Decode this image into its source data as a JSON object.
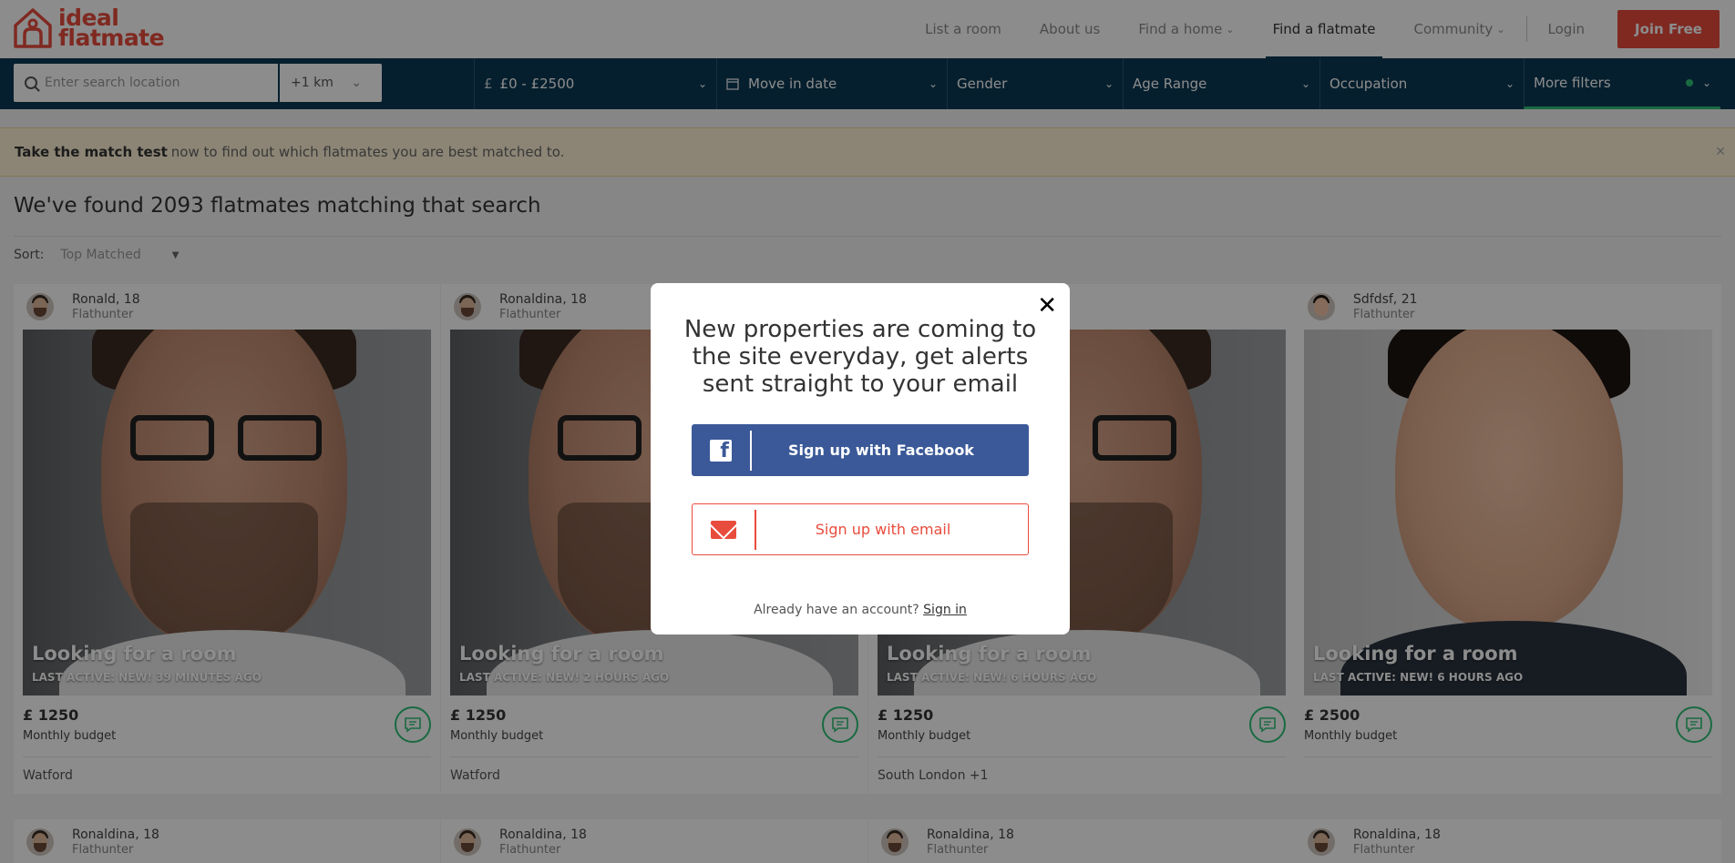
{
  "brand": {
    "line1": "ideal",
    "line2": "flatmate",
    "color": "#e84c3d"
  },
  "nav": {
    "items": [
      {
        "label": "List a room",
        "chevron": false,
        "active": false
      },
      {
        "label": "About us",
        "chevron": false,
        "active": false
      },
      {
        "label": "Find a home",
        "chevron": true,
        "active": false
      },
      {
        "label": "Find a flatmate",
        "chevron": false,
        "active": true
      },
      {
        "label": "Community",
        "chevron": true,
        "active": false
      }
    ],
    "login": "Login",
    "join": "Join Free"
  },
  "filters": {
    "search_placeholder": "Enter search location",
    "radius": "+1 km",
    "price_symbol": "£",
    "price": "£0 - £2500",
    "move_in": "Move in date",
    "gender": "Gender",
    "age": "Age Range",
    "occupation": "Occupation",
    "more": "More filters"
  },
  "banner": {
    "bold": "Take the match test",
    "rest": "now to find out which flatmates you are best matched to.",
    "close": "✕"
  },
  "results_title": "We've found 2093 flatmates matching that search",
  "sort": {
    "label": "Sort:",
    "value": "Top Matched",
    "caret": "▼"
  },
  "cards": [
    {
      "name": "Ronald, 18",
      "role": "Flathunter",
      "title": "Looking for a room",
      "active": "LAST ACTIVE: NEW! 39 MINUTES AGO",
      "price": "£ 1250",
      "budget_label": "Monthly budget",
      "location": "Watford"
    },
    {
      "name": "Ronaldina, 18",
      "role": "Flathunter",
      "title": "Looking for a room",
      "active": "LAST ACTIVE: NEW! 2 HOURS AGO",
      "price": "£ 1250",
      "budget_label": "Monthly budget",
      "location": "Watford"
    },
    {
      "name": "",
      "role": "",
      "title": "Looking for a room",
      "active": "LAST ACTIVE: NEW! 6 HOURS AGO",
      "price": "£ 1250",
      "budget_label": "Monthly budget",
      "location": "South London +1"
    },
    {
      "name": "Sdfdsf, 21",
      "role": "Flathunter",
      "title": "Looking for a room",
      "active": "LAST ACTIVE: NEW! 6 HOURS AGO",
      "price": "£ 2500",
      "budget_label": "Monthly budget",
      "location": ""
    }
  ],
  "cards_row2": [
    {
      "name": "Ronaldina, 18",
      "role": "Flathunter"
    },
    {
      "name": "Ronaldina, 18",
      "role": "Flathunter"
    },
    {
      "name": "Ronaldina, 18",
      "role": "Flathunter"
    },
    {
      "name": "Ronaldina, 18",
      "role": "Flathunter"
    }
  ],
  "modal": {
    "close": "✕",
    "title": "New properties are coming to the site everyday, get alerts sent straight to your email",
    "facebook": "Sign up with Facebook",
    "facebook_icon": "f",
    "email": "Sign up with email",
    "signin_prompt": "Already have an account?",
    "signin_link": "Sign in"
  },
  "colors": {
    "navy": "#0b3a55",
    "accent": "#e84c3d",
    "green": "#2ec277",
    "facebook": "#3b5998"
  }
}
